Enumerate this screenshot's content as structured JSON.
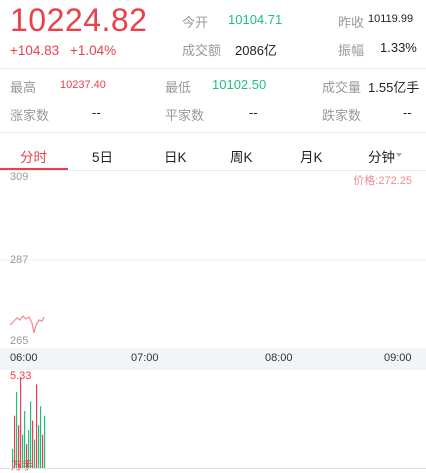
{
  "quote": {
    "price": "10224.82",
    "change": "+104.83",
    "change_pct": "+1.04%"
  },
  "stats_top": [
    {
      "label": "今开",
      "value": "10104.71",
      "value_color": "green"
    },
    {
      "label": "成交额",
      "value": "2086亿",
      "value_color": "dark"
    },
    {
      "label": "昨收",
      "value": "10119.99",
      "value_color": "dark"
    },
    {
      "label": "振幅",
      "value": "1.33%",
      "value_color": "dark"
    }
  ],
  "stats_grid": {
    "high_label": "最高",
    "high_value": "10237.40",
    "low_label": "最低",
    "low_value": "10102.50",
    "volume_label": "成交量",
    "volume_value": "1.55亿手",
    "rise_label": "涨家数",
    "rise_value": "--",
    "flat_label": "平家数",
    "flat_value": "--",
    "fall_label": "跌家数",
    "fall_value": "--"
  },
  "tabs": [
    {
      "label": "分时",
      "active": true
    },
    {
      "label": "5日",
      "active": false
    },
    {
      "label": "日K",
      "active": false
    },
    {
      "label": "周K",
      "active": false
    },
    {
      "label": "月K",
      "active": false
    },
    {
      "label": "分钟",
      "active": false
    }
  ],
  "chart": {
    "y_labels": [
      "309",
      "287",
      "265"
    ],
    "price_label": "价格:272.25",
    "time_labels": [
      "06:00",
      "07:00",
      "08:00",
      "09:00"
    ],
    "volume_max": "5.33",
    "volume_unit": "万手"
  },
  "colors": {
    "up": "#e8414b",
    "down": "#1fbf7e",
    "muted": "#999999",
    "timebar_bg": "#f2f4f8"
  }
}
